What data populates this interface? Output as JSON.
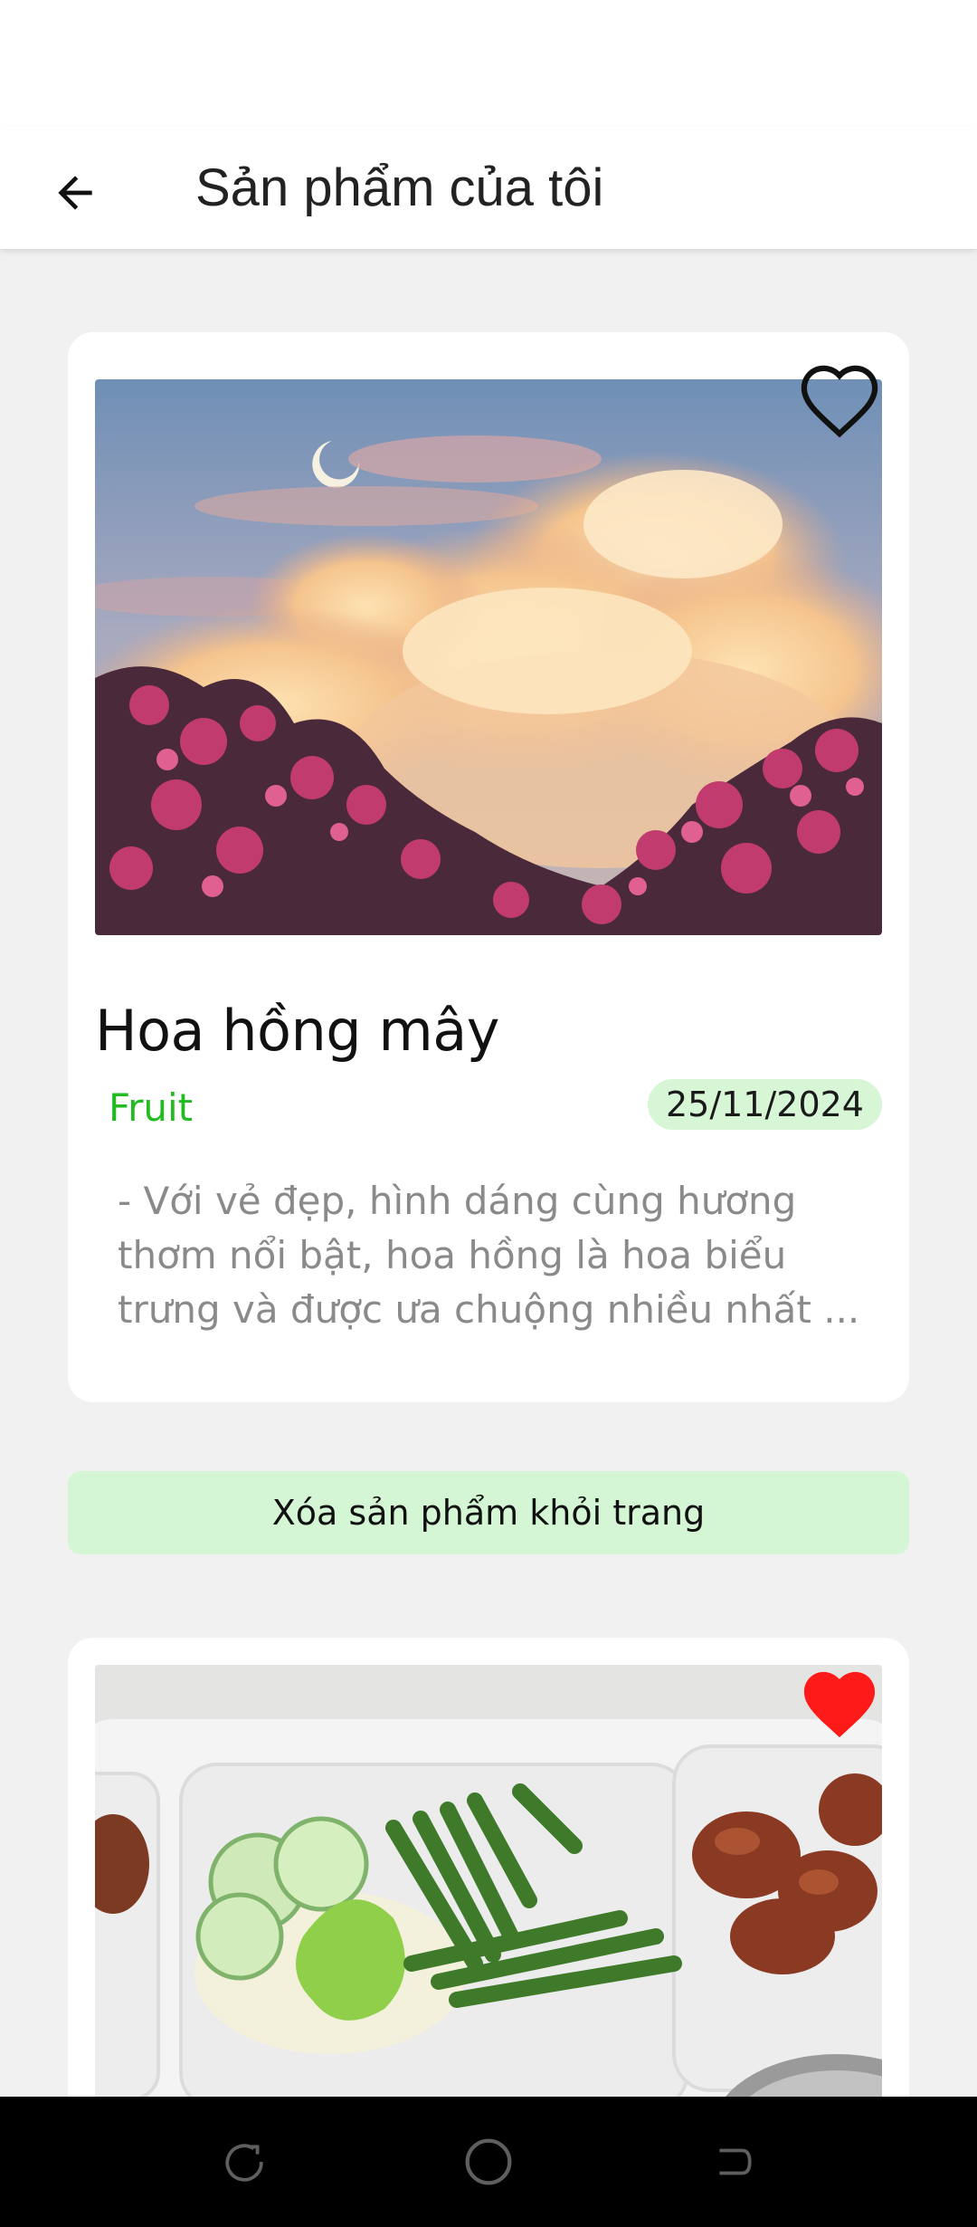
{
  "app_bar": {
    "title": "Sản phẩm của tôi",
    "back_icon": "arrow-left-icon"
  },
  "products": [
    {
      "title": "Hoa hồng mây",
      "category": "Fruit",
      "date": "25/11/2024",
      "description": "- Với vẻ đẹp, hình dáng cùng hương thơm nổi bật, hoa hồng là hoa biểu trưng và được ưa chuộng nhiều nhất ...",
      "favorite": false,
      "image_subject": "pink flowers under sunset clouds"
    },
    {
      "favorite": true,
      "image_subject": "meal tray with vegetables and braised meat"
    }
  ],
  "remove_button": {
    "label": "Xóa sản phẩm khỏi trang"
  },
  "colors": {
    "category_green": "#22bb22",
    "badge_bg": "#d6f6d6",
    "remove_bg": "#d4f6d4",
    "heart_red": "#ff1a1a",
    "background": "#f1f1f1"
  },
  "nav_bar": {
    "recents_icon": "recents-icon",
    "home_icon": "home-circle-icon",
    "back_icon": "nav-back-icon"
  }
}
